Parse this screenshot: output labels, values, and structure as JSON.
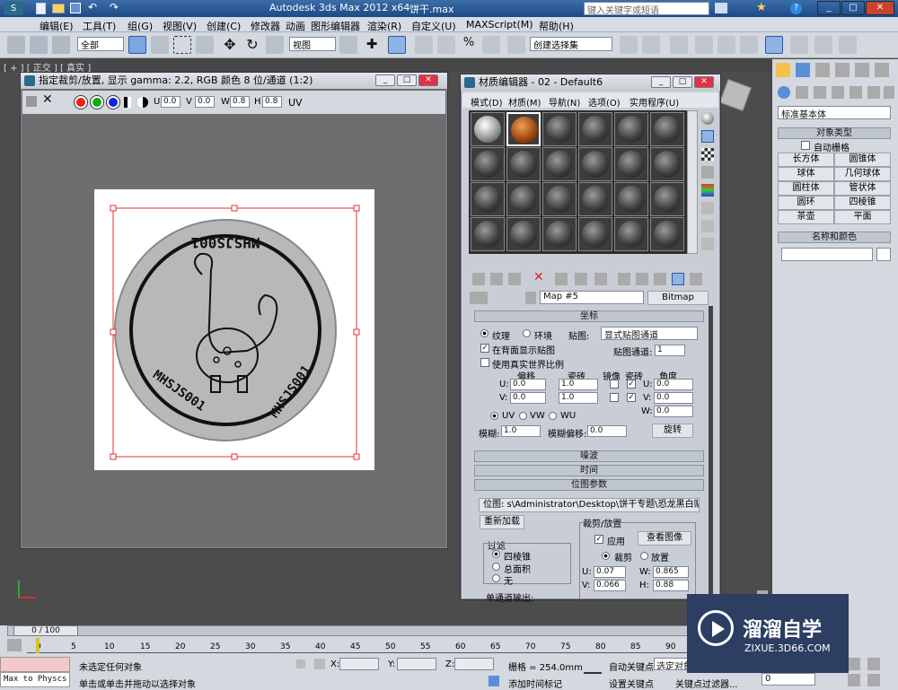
{
  "title_bar": {
    "app_title": "Autodesk 3ds Max  2012 x64",
    "file_name": "饼干.max",
    "search_placeholder": "键入关键字或短语"
  },
  "menu_items": [
    "编辑(E)",
    "工具(T)",
    "组(G)",
    "视图(V)",
    "创建(C)",
    "修改器",
    "动画",
    "图形编辑器",
    "渲染(R)",
    "自定义(U)",
    "MAXScript(M)",
    "帮助(H)"
  ],
  "toolbar": {
    "selection_filter": "全部",
    "reference_coord": "视图",
    "named_selection": "创建选择集"
  },
  "viewport_label": "[ + ] [ 正交 ] [ 真实 ]",
  "crop_window": {
    "title": "指定裁剪/放置, 显示 gamma: 2.2, RGB 颜色 8 位/通道 (1:2)",
    "u_label": "U",
    "u_value": "0.0",
    "v_label": "V",
    "v_value": "0.0",
    "w_label": "W",
    "w_value": "0.8",
    "h_label": "H",
    "h_value": "0.8",
    "uv_label": "UV",
    "text_top": "MHSJS001",
    "text_left": "MHSJS001",
    "text_right": "MHSJS001"
  },
  "material_editor": {
    "title": "材质编辑器 - 02 - Default6",
    "menus": [
      "模式(D)",
      "材质(M)",
      "导航(N)",
      "选项(O)",
      "实用程序(U)"
    ],
    "map_name": "Map #5",
    "map_type": "Bitmap",
    "coord_header": "坐标",
    "texture_label": "纹理",
    "environ_label": "环境",
    "mapping_label": "贴图:",
    "mapping_value": "显式贴图通道",
    "show_back_label": "在背面显示贴图",
    "map_channel_label": "贴图通道:",
    "map_channel_value": "1",
    "real_world_label": "使用真实世界比例",
    "offset_label": "偏移",
    "tiling_label": "瓷砖",
    "mirror_label": "镜像",
    "tile_label": "瓷砖",
    "angle_label": "角度",
    "u_off": "0.0",
    "v_off": "0.0",
    "u_tile": "1.0",
    "v_tile": "1.0",
    "u_ang": "0.0",
    "v_ang": "0.0",
    "w_ang": "0.0",
    "u_lbl": "U:",
    "v_lbl": "V:",
    "w_lbl": "W:",
    "uv_opt": "UV",
    "vw_opt": "VW",
    "wu_opt": "WU",
    "blur_label": "模糊:",
    "blur_value": "1.0",
    "blur_offset_label": "模糊偏移:",
    "blur_offset_value": "0.0",
    "rotate_btn": "旋转",
    "noise_header": "噪波",
    "time_header": "时间",
    "bitmap_params_header": "位图参数",
    "bitmap_path": "位图:  s\\Administrator\\Desktop\\饼干专题\\恐龙黑白贴图.jpg",
    "reload_btn": "重新加载",
    "filter_label": "过滤",
    "pyramidal": "四棱锥",
    "summed_area": "总面积",
    "none_opt": "无",
    "crop_place_label": "裁剪/放置",
    "apply_label": "应用",
    "view_image_btn": "查看图像",
    "crop_opt": "裁剪",
    "place_opt": "放置",
    "crop_u": "0.07",
    "crop_v": "0.066",
    "crop_w": "0.865",
    "crop_h": "0.88",
    "c_u": "U:",
    "c_v": "V:",
    "c_w": "W:",
    "c_h": "H:",
    "mono_output": "单通道输出:"
  },
  "command_panel": {
    "dropdown": "标准基本体",
    "object_type_header": "对象类型",
    "autogrid": "自动栅格",
    "buttons": [
      "长方体",
      "圆锥体",
      "球体",
      "几何球体",
      "圆柱体",
      "管状体",
      "圆环",
      "四棱锥",
      "茶壶",
      "平面"
    ],
    "name_color_header": "名称和颜色"
  },
  "timeline": {
    "frame_label": "0 / 100",
    "ticks": [
      "0",
      "5",
      "10",
      "15",
      "20",
      "25",
      "30",
      "35",
      "40",
      "45",
      "50",
      "55",
      "60",
      "65",
      "70",
      "75",
      "80",
      "85",
      "90"
    ]
  },
  "status": {
    "script_box": "Max to Physcs (",
    "no_selection": "未选定任何对象",
    "prompt": "单击或单击并拖动以选择对象",
    "x_label": "X:",
    "y_label": "Y:",
    "z_label": "Z:",
    "grid": "栅格 = 254.0mm",
    "add_time_tag": "添加时间标记",
    "auto_key": "自动关键点",
    "selected": "选定对象",
    "set_key": "设置关键点",
    "key_filters": "关键点过滤器...",
    "frame_value": "0"
  },
  "watermark": {
    "name_cn": "溜溜自学",
    "url": "ZIXUE.3D66.COM"
  },
  "colors": {
    "title_blue": "#1e4a86",
    "panel_gray": "#d4d8df",
    "viewport_gray": "#4c4c4c",
    "red_bbox": "#e03030",
    "watermark_bg": "#2d3e63"
  }
}
